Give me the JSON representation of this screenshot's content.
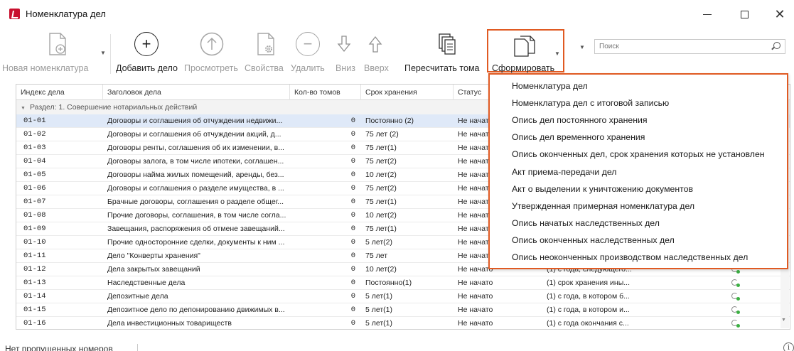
{
  "window": {
    "title": "Номенклатура дел"
  },
  "toolbar": {
    "new_nomenclature": "Новая номенклатура",
    "add_case": "Добавить дело",
    "view": "Просмотреть",
    "properties": "Свойства",
    "delete": "Удалить",
    "down": "Вниз",
    "up": "Вверх",
    "recalc_volumes": "Пересчитать тома",
    "generate": "Сформировать"
  },
  "search": {
    "placeholder": "Поиск"
  },
  "grid": {
    "columns": [
      "Индекс дела",
      "Заголовок дела",
      "Кол-во томов",
      "Срок хранения",
      "Статус"
    ],
    "group_label": "Раздел: 1. Совершение нотариальных действий",
    "rows": [
      {
        "index": "01-01",
        "title": "Договоры и соглашения об отчуждении недвижи...",
        "volumes": "0",
        "retention": "Постоянно (2)",
        "status": "Не начат",
        "note": ""
      },
      {
        "index": "01-02",
        "title": "Договоры и соглашения об отчуждении акций, д...",
        "volumes": "0",
        "retention": "75 лет (2)",
        "status": "Не начат",
        "note": ""
      },
      {
        "index": "01-03",
        "title": "Договоры ренты, соглашения об их изменении, в...",
        "volumes": "0",
        "retention": "75 лет(1)",
        "status": "Не начат",
        "note": ""
      },
      {
        "index": "01-04",
        "title": "Договоры залога, в том числе ипотеки, соглашен...",
        "volumes": "0",
        "retention": "75 лет(2)",
        "status": "Не начат",
        "note": ""
      },
      {
        "index": "01-05",
        "title": "Договоры найма жилых помещений, аренды, без...",
        "volumes": "0",
        "retention": "10 лет(2)",
        "status": "Не начат",
        "note": ""
      },
      {
        "index": "01-06",
        "title": "Договоры и соглашения о разделе имущества, в ...",
        "volumes": "0",
        "retention": "75 лет(2)",
        "status": "Не начат",
        "note": ""
      },
      {
        "index": "01-07",
        "title": "Брачные договоры, соглашения о разделе общег...",
        "volumes": "0",
        "retention": "75 лет(1)",
        "status": "Не начат",
        "note": ""
      },
      {
        "index": "01-08",
        "title": "Прочие договоры, соглашения, в том числе согла...",
        "volumes": "0",
        "retention": "10 лет(2)",
        "status": "Не начат",
        "note": ""
      },
      {
        "index": "01-09",
        "title": "Завещания, распоряжения об отмене завещаний...",
        "volumes": "0",
        "retention": "75 лет(1)",
        "status": "Не начат",
        "note": ""
      },
      {
        "index": "01-10",
        "title": "Прочие односторонние сделки, документы к ним ...",
        "volumes": "0",
        "retention": "5 лет(2)",
        "status": "Не начат",
        "note": ""
      },
      {
        "index": "01-11",
        "title": "Дело \"Конверты хранения\"",
        "volumes": "0",
        "retention": "75 лет",
        "status": "Не начат",
        "note": ""
      },
      {
        "index": "01-12",
        "title": "Дела закрытых завещаний",
        "volumes": "0",
        "retention": "10 лет(2)",
        "status": "Не начато",
        "note": "(1) с года, следующего..."
      },
      {
        "index": "01-13",
        "title": "Наследственные дела",
        "volumes": "0",
        "retention": "Постоянно(1)",
        "status": "Не начато",
        "note": "(1) срок хранения ины..."
      },
      {
        "index": "01-14",
        "title": "Депозитные дела",
        "volumes": "0",
        "retention": "5 лет(1)",
        "status": "Не начато",
        "note": "(1) с года, в котором б..."
      },
      {
        "index": "01-15",
        "title": "Депозитное дело по депонированию движимых в...",
        "volumes": "0",
        "retention": "5 лет(1)",
        "status": "Не начато",
        "note": "(1) с года, в котором и..."
      },
      {
        "index": "01-16",
        "title": "Дела инвестиционных товариществ",
        "volumes": "0",
        "retention": "5 лет(1)",
        "status": "Не начато",
        "note": "(1) с года окончания с..."
      }
    ]
  },
  "menu": {
    "items": [
      "Номенклатура дел",
      "Номенклатура дел с итоговой записью",
      "Опись дел постоянного хранения",
      "Опись дел временного хранения",
      "Опись оконченных дел, срок хранения которых не установлен",
      "Акт приема-передачи дел",
      "Акт о выделении к уничтожению документов",
      "Утвержденная примерная номенклатура дел",
      "Опись начатых наследственных дел",
      "Опись оконченных наследственных дел",
      "Опись неоконченных производством наследственных дел"
    ]
  },
  "status": {
    "text": "Нет пропущенных номеров"
  },
  "colors": {
    "highlight_border": "#e05a22",
    "selected_row": "#dfe9f8",
    "app_icon": "#c8102e"
  }
}
